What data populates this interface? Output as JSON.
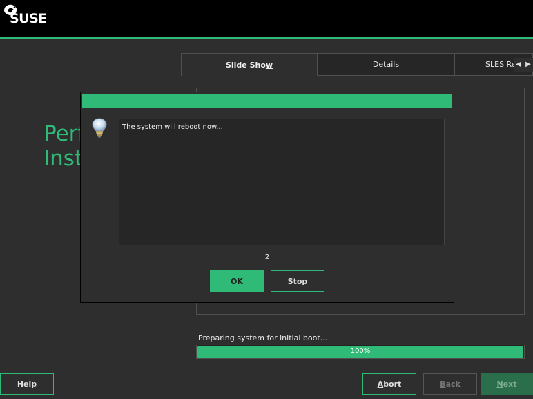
{
  "header": {
    "logo_text": "SUSE",
    "accent_color": "#30ba78"
  },
  "background_title": "Perform\nInstallation",
  "tabs": [
    {
      "label": "Slide Show",
      "mnemonic_index": 9,
      "active": true
    },
    {
      "label": "Details",
      "mnemonic_index": 0,
      "active": false
    },
    {
      "label": "SLES Re",
      "mnemonic_index": 0,
      "active": false
    }
  ],
  "tab_scroll": {
    "left_icon": "arrow-left-icon",
    "right_icon": "arrow-right-icon"
  },
  "progress": {
    "label": "Preparing system for initial boot...",
    "value_text": "100%",
    "value": 100
  },
  "dialog": {
    "icon": "lightbulb-icon",
    "message": "The system will reboot now...",
    "countdown": "2",
    "ok_label": "OK",
    "stop_label": "Stop"
  },
  "footer": {
    "help_label": "Help",
    "abort_label": "Abort",
    "back_label": "Back",
    "next_label": "Next"
  }
}
